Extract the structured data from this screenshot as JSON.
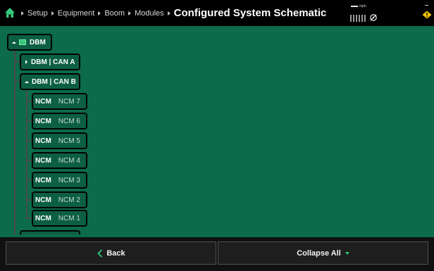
{
  "header": {
    "breadcrumbs": [
      "Setup",
      "Equipment",
      "Boom",
      "Modules"
    ],
    "title": "Configured System Schematic",
    "speed_value": "--",
    "speed_unit": "mph"
  },
  "tree": {
    "root": {
      "label": "DBM",
      "expanded": true
    },
    "can_a": {
      "label": "DBM | CAN A",
      "expanded": false
    },
    "can_b": {
      "label": "DBM | CAN B",
      "expanded": true
    },
    "ncm_nodes": [
      {
        "type": "NCM",
        "name": "NCM 7"
      },
      {
        "type": "NCM",
        "name": "NCM 6"
      },
      {
        "type": "NCM",
        "name": "NCM 5"
      },
      {
        "type": "NCM",
        "name": "NCM 4"
      },
      {
        "type": "NCM",
        "name": "NCM 3"
      },
      {
        "type": "NCM",
        "name": "NCM 2"
      },
      {
        "type": "NCM",
        "name": "NCM 1"
      }
    ]
  },
  "footer": {
    "back_label": "Back",
    "collapse_label": "Collapse All"
  },
  "colors": {
    "background": "#0b6b4b",
    "accent": "#35c77a",
    "warning": "#f2c500"
  },
  "icons": [
    "home-icon",
    "signal-icon",
    "gps-icon",
    "warning-icon",
    "module-icon",
    "chevron-left-icon",
    "caret-down-icon"
  ]
}
